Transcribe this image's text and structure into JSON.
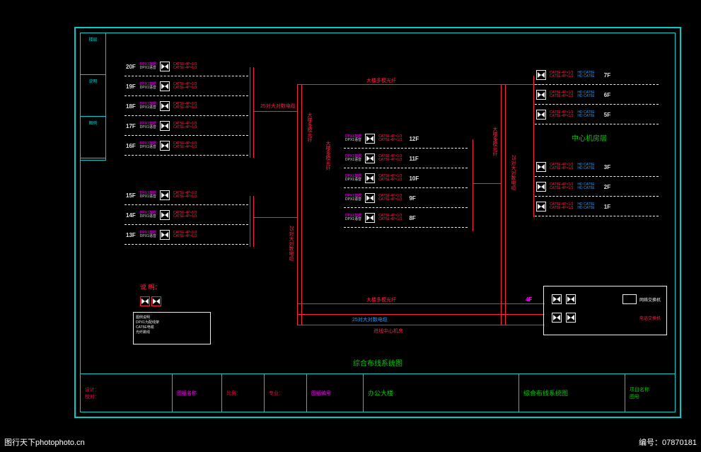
{
  "watermark": "图行天下photophoto.cn",
  "image_id_label": "编号：07870181",
  "caption": "综合布线系统图",
  "titleblock": {
    "c1a": "设计：",
    "c1b": "校对：",
    "c2": "图纸名称",
    "c3": "比例：",
    "c4": "专业：",
    "c5": "图纸编号",
    "building": "办公大楼",
    "drawing_name": "综合布线系统图",
    "serial_label": "项目名称",
    "page_label": "图号"
  },
  "side_cells": [
    "楼层",
    "说明",
    "图例"
  ],
  "cable_labels": {
    "fiber_h1": "大楼多模光纤",
    "fiber_h2": "大楼多模光纤",
    "fiber_h3": "大楼多模光纤",
    "fiber_h4": "大楼多模光纤",
    "cable25_1": "25对大对数电缆",
    "cable25_2": "25对大对数电缆",
    "cable25_3": "25对大对数电缆",
    "cable25_4": "25对大对数电缆",
    "room_entry": "进线中心机房"
  },
  "center_room": "中心机房层",
  "legend_title": "说 明：",
  "legend_rows": [
    "图例说明",
    "DPX1为配线架",
    "CAT5E电缆",
    "光纤跳线"
  ],
  "server": {
    "net_sw": "网络交换机",
    "tel_sw": "电话交换机"
  },
  "floor_text": {
    "blue1": "HD CAT5E",
    "mag1": "DPX1数据",
    "wht1": "DPX1语音",
    "cable_red": "CAT5E-4P×1/3",
    "cable_blu": "CAT5E-4P×1/3"
  },
  "left_stack_a": [
    {
      "fl": "20F"
    },
    {
      "fl": "19F"
    },
    {
      "fl": "18F"
    },
    {
      "fl": "17F"
    },
    {
      "fl": "16F"
    }
  ],
  "left_stack_b": [
    {
      "fl": "15F"
    },
    {
      "fl": "14F"
    },
    {
      "fl": "13F"
    }
  ],
  "mid_stack": [
    {
      "fl": "12F"
    },
    {
      "fl": "11F"
    },
    {
      "fl": "10F"
    },
    {
      "fl": "9F"
    },
    {
      "fl": "8F"
    }
  ],
  "right_stack_a": [
    {
      "fl": "7F"
    },
    {
      "fl": "6F"
    },
    {
      "fl": "5F"
    }
  ],
  "right_stack_b": [
    {
      "fl": "3F"
    },
    {
      "fl": "2F"
    },
    {
      "fl": "1F"
    }
  ],
  "basement_fl": "4F"
}
